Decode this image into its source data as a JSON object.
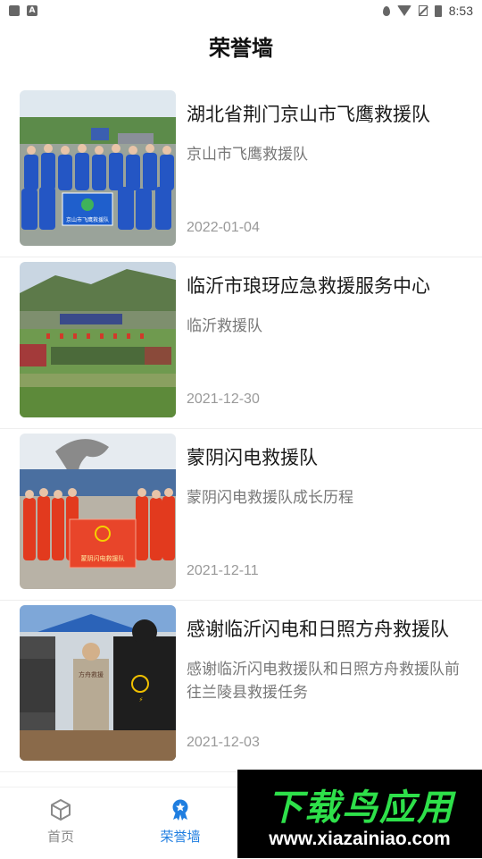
{
  "status_bar": {
    "time": "8:53",
    "left_icons": [
      "image-icon",
      "a-icon"
    ],
    "right_icons": [
      "location-icon",
      "wifi-icon",
      "no-sim-icon",
      "battery-icon"
    ]
  },
  "header": {
    "title": "荣誉墙"
  },
  "items": [
    {
      "title": "湖北省荆门京山市飞鹰救援队",
      "description": "京山市飞鹰救援队",
      "date": "2022-01-04",
      "banner_text": "京山市飞鹰救援队"
    },
    {
      "title": "临沂市琅玡应急救援服务中心",
      "description": "临沂救援队",
      "date": "2021-12-30"
    },
    {
      "title": "蒙阴闪电救援队",
      "description": "蒙阴闪电救援队成长历程",
      "date": "2021-12-11",
      "banner_text": "蒙阴闪电救援队"
    },
    {
      "title": "感谢临沂闪电和日照方舟救援队",
      "description": "感谢临沂闪电救援队和日照方舟救援队前往兰陵县救援任务",
      "date": "2021-12-03",
      "shirt_text": "方舟救援"
    }
  ],
  "tabbar": {
    "tabs": [
      {
        "label": "首页",
        "icon": "cube-icon",
        "active": false
      },
      {
        "label": "荣誉墙",
        "icon": "medal-icon",
        "active": true
      }
    ],
    "active_color": "#1f7ee0",
    "inactive_color": "#8a8a8a"
  },
  "watermark": {
    "brand": "下载鸟应用",
    "url": "www.xiazainiao.com",
    "color": "#2ee04a"
  }
}
